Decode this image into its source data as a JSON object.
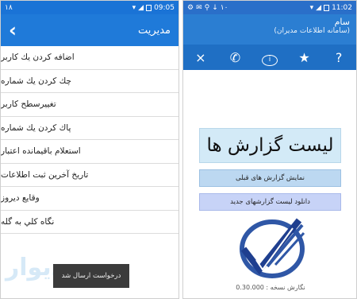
{
  "left": {
    "status": {
      "left": "۱۸",
      "time": "09:05"
    },
    "appbar": {
      "title": "مديريت"
    },
    "menu": [
      "اضافه کردن یك کاربر",
      "چك کردن یك شماره",
      "تغییرسطح کاربر",
      "پاك کردن یك شماره",
      "استعلام باقیمانده اعتبار",
      "تاریخ آخرین ثبت اطلاعات",
      "وقايع ديروز",
      "نگاه كلي به گله"
    ],
    "toast": "درخواست ارسال شد",
    "watermark": "دیوار"
  },
  "right": {
    "status": {
      "left": "۱۰",
      "time": "11:02"
    },
    "header": {
      "title": "سام",
      "subtitle": "(سامانه اطلاعات مدیران)"
    },
    "toolbar": {
      "close": "×",
      "call": "✆",
      "info": "i",
      "star": "★",
      "help": "?"
    },
    "big_title": "لیست گزارش ها",
    "btn_prev": "نمایش گزارش های قبلی",
    "btn_download": "دانلود لیست گزارشهای جدید",
    "version": "نگارش نسخه : 0.30.000"
  }
}
